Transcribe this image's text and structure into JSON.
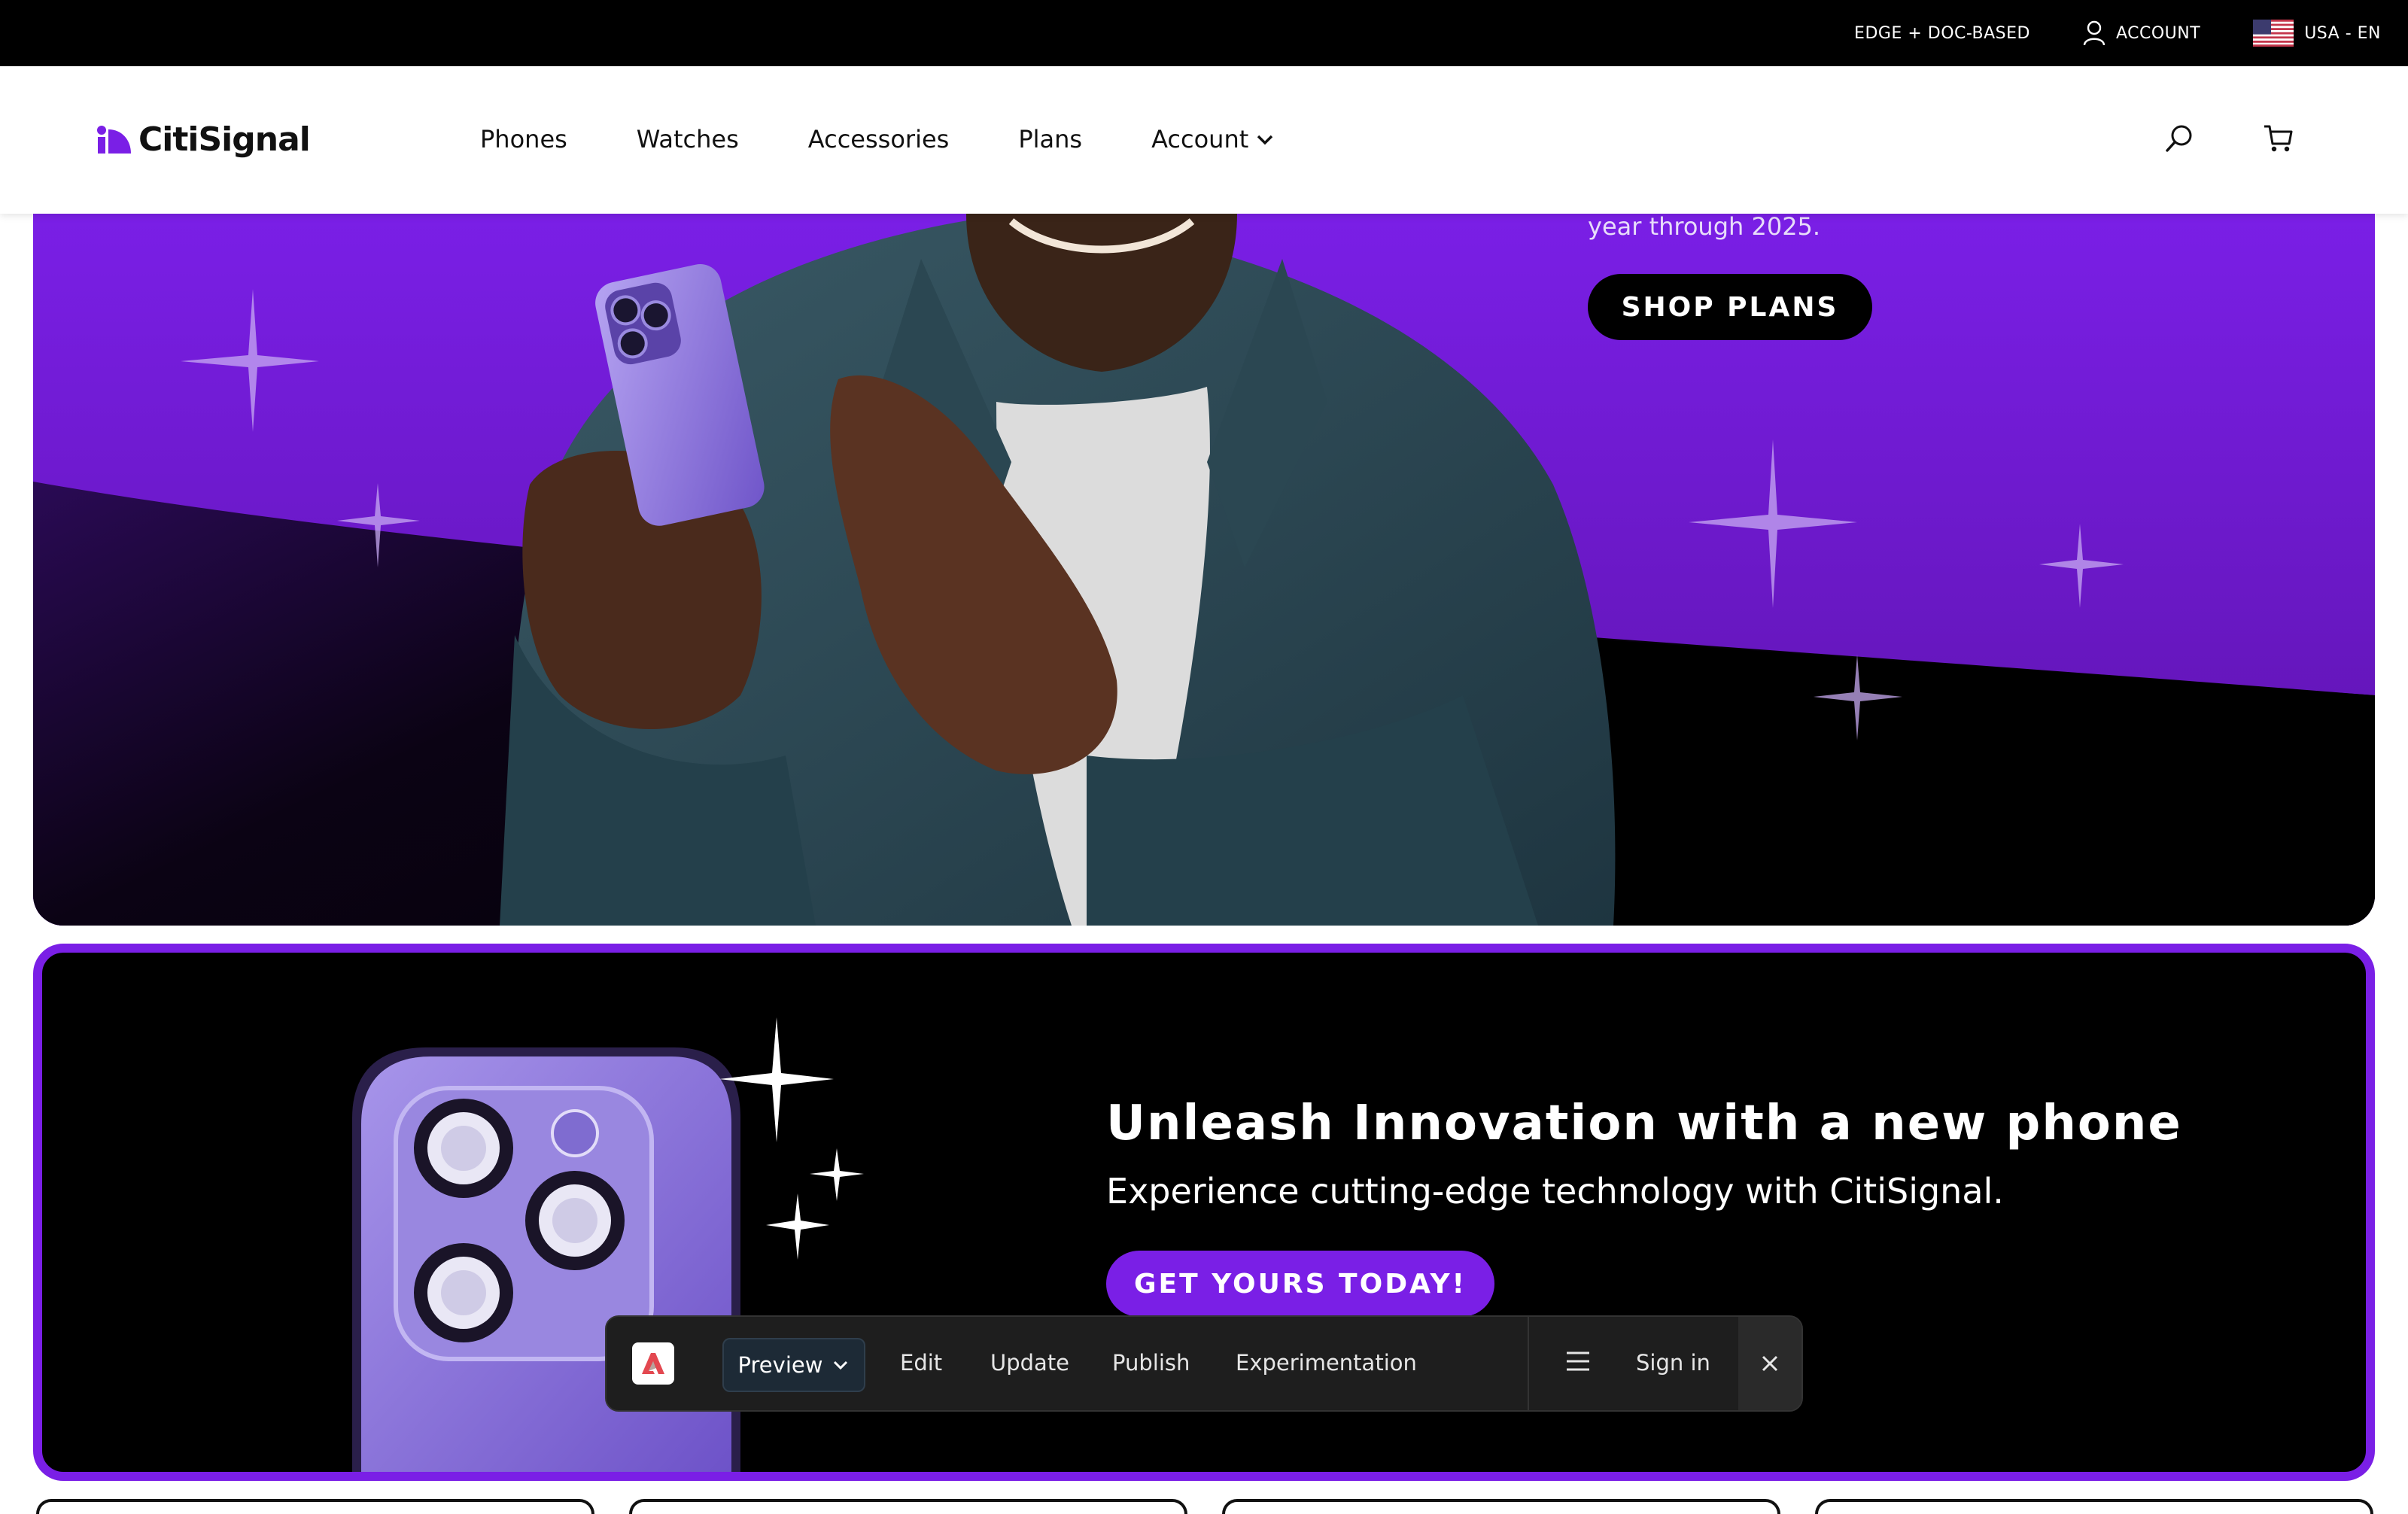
{
  "topbar": {
    "brand_site": "EDGE + DOC-BASED",
    "account": "ACCOUNT",
    "locale": "USA - EN"
  },
  "nav": {
    "logo": "CitiSignal",
    "items": [
      "Phones",
      "Watches",
      "Accessories",
      "Plans",
      "Account"
    ]
  },
  "hero": {
    "copy_tail": "year through 2025.",
    "cta": "SHOP PLANS"
  },
  "promo": {
    "title": "Unleash Innovation with a new phone",
    "subtitle": "Experience cutting-edge technology with CitiSignal.",
    "cta": "GET YOURS TODAY!"
  },
  "sidekick": {
    "preview": "Preview",
    "edit": "Edit",
    "update": "Update",
    "publish": "Publish",
    "experimentation": "Experimentation",
    "sign_in": "Sign in"
  },
  "colors": {
    "brand_purple": "#7a1fe6",
    "hero_purple": "#6e16c9",
    "black": "#000000"
  },
  "icons": {
    "account": "user-icon",
    "locale": "us-flag-icon",
    "search": "search-icon",
    "cart": "cart-icon",
    "menu": "hamburger-icon",
    "close": "close-icon"
  }
}
